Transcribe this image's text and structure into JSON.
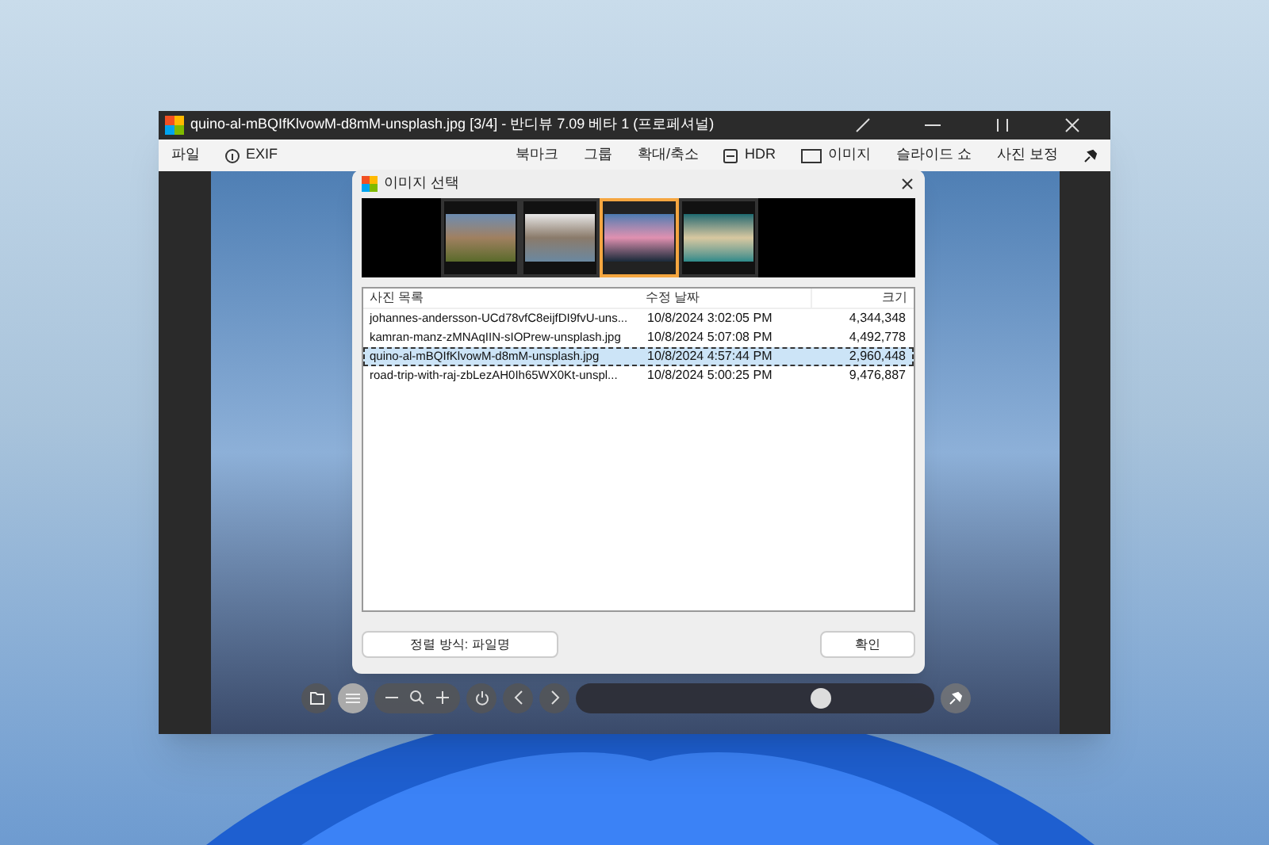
{
  "window": {
    "title": "quino-al-mBQIfKlvowM-d8mM-unsplash.jpg [3/4] - 반디뷰 7.09 베타 1 (프로페셔널)"
  },
  "menu": [
    {
      "kind": "text",
      "label": "파일"
    },
    {
      "kind": "exif",
      "label": "EXIF"
    },
    {
      "kind": "spacer"
    },
    {
      "kind": "text",
      "label": "북마크"
    },
    {
      "kind": "text",
      "label": "그룹"
    },
    {
      "kind": "text",
      "label": "확대/축소"
    },
    {
      "kind": "hdr",
      "label": "HDR"
    },
    {
      "kind": "image",
      "label": "이미지"
    },
    {
      "kind": "text",
      "label": "슬라이드 쇼"
    },
    {
      "kind": "text",
      "label": "사진 보정"
    },
    {
      "kind": "pin"
    }
  ],
  "dialog": {
    "title": "이미지 선택",
    "thumbnails": [
      {
        "selected": false
      },
      {
        "selected": false
      },
      {
        "selected": true
      },
      {
        "selected": false
      }
    ],
    "columns": [
      "사진 목록",
      "수정 날짜",
      "크기"
    ],
    "rows": [
      {
        "name": "johannes-andersson-UCd78vfC8eijfDI9fvU-uns...",
        "date": "10/8/2024 3:02:05 PM",
        "size": "4,344,348",
        "selected": false
      },
      {
        "name": "kamran-manz-zMNAqIIN-sIOPrew-unsplash.jpg",
        "date": "10/8/2024 5:07:08 PM",
        "size": "4,492,778",
        "selected": false
      },
      {
        "name": "quino-al-mBQIfKlvowM-d8mM-unsplash.jpg",
        "date": "10/8/2024 4:57:44 PM",
        "size": "2,960,448",
        "selected": true
      },
      {
        "name": "road-trip-with-raj-zbLezAH0Ih65WX0Kt-unspl...",
        "date": "10/8/2024 5:00:25 PM",
        "size": "9,476,887",
        "selected": false
      }
    ],
    "sort_button": "정렬 방식: 파일명",
    "ok_button": "확인"
  },
  "toolbar": {
    "slider": {
      "level": 0.68
    }
  }
}
